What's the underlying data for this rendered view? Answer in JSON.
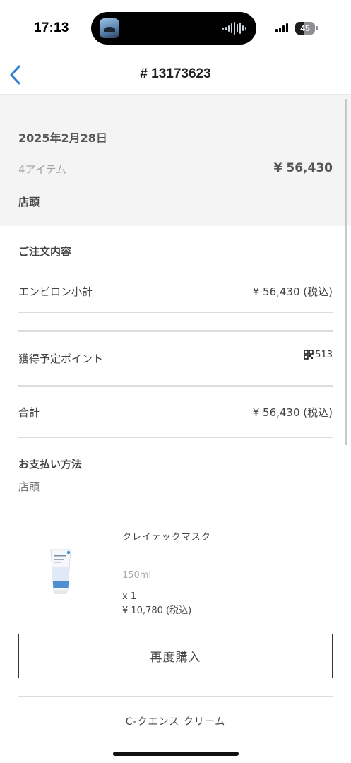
{
  "status_bar": {
    "time": "17:13",
    "battery": "45",
    "battery_level": 0.45
  },
  "nav": {
    "title": "# 13173623",
    "back_icon": "chevron-left-icon",
    "accent_color": "#2f7fd6"
  },
  "summary": {
    "date": "2025年2月28日",
    "item_count": "4アイテム",
    "total": "¥ 56,430",
    "store": "店頭"
  },
  "order": {
    "section_title": "ご注文内容",
    "subtotal_label": "エンビロン小計",
    "subtotal_value": "¥ 56,430 (税込)",
    "points_label": "獲得予定ポイント",
    "points_icon": "points-grid-icon",
    "points_value": "513",
    "total_label": "合計",
    "total_value": "¥ 56,430 (税込)"
  },
  "payment": {
    "title": "お支払い方法",
    "method": "店頭"
  },
  "product": {
    "name": "クレイテックマスク",
    "size": "150ml",
    "qty": "x 1",
    "price": "¥ 10,780 (税込)",
    "rebuy_label": "再度購入"
  },
  "next_product": {
    "name": "C-クエンス クリーム"
  }
}
